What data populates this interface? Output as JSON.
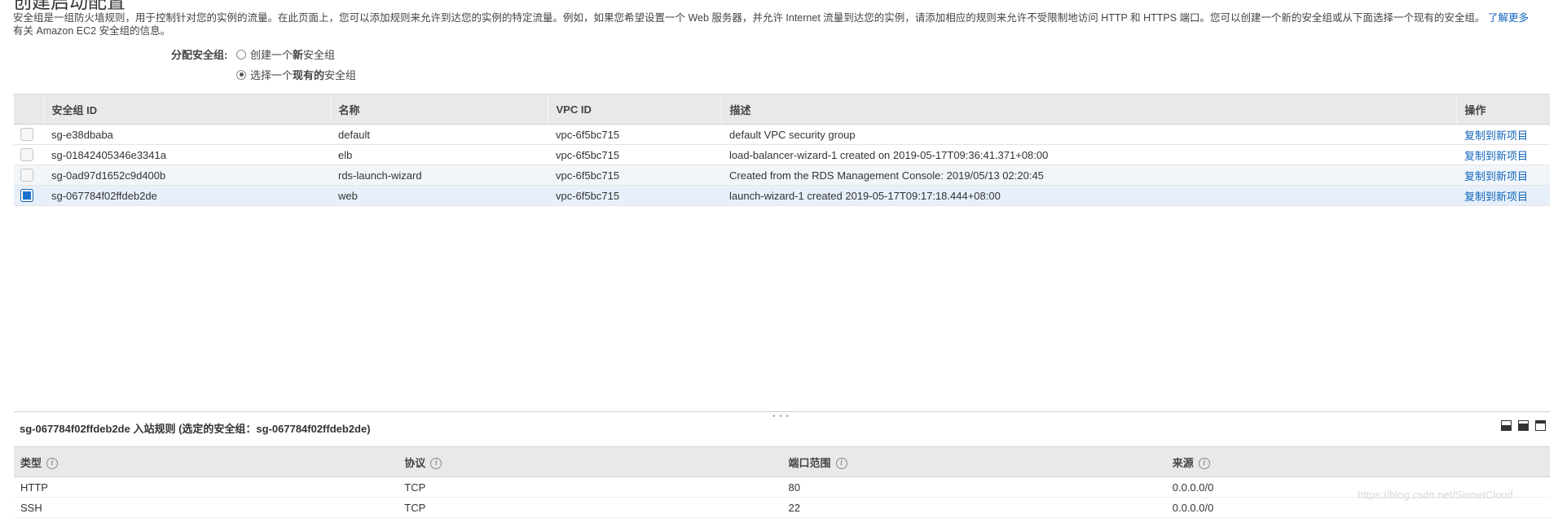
{
  "page": {
    "title": "创建启动配置",
    "description": "安全组是一组防火墙规则，用于控制针对您的实例的流量。在此页面上，您可以添加规则来允许到达您的实例的特定流量。例如，如果您希望设置一个 Web 服务器，并允许 Internet 流量到达您的实例，请添加相应的规则来允许不受限制地访问 HTTP 和 HTTPS 端口。您可以创建一个新的安全组或从下面选择一个现有的安全组。",
    "learn_more": "了解更多",
    "description_tail": "有关 Amazon EC2 安全组的信息。"
  },
  "assign": {
    "label": "分配安全组:",
    "option_new_prefix": "创建一个",
    "option_new_bold": "新",
    "option_new_suffix": "安全组",
    "option_existing_prefix": "选择一个",
    "option_existing_bold": "现有的",
    "option_existing_suffix": "安全组",
    "selected": "existing"
  },
  "groups_table": {
    "columns": [
      "安全组 ID",
      "名称",
      "VPC ID",
      "描述",
      "操作"
    ],
    "rows": [
      {
        "id": "sg-e38dbaba",
        "name": "default",
        "vpc": "vpc-6f5bc715",
        "desc": "default VPC security group",
        "action": "复制到新项目",
        "checked": false
      },
      {
        "id": "sg-01842405346e3341a",
        "name": "elb",
        "vpc": "vpc-6f5bc715",
        "desc": "load-balancer-wizard-1 created on 2019-05-17T09:36:41.371+08:00",
        "action": "复制到新项目",
        "checked": false
      },
      {
        "id": "sg-0ad97d1652c9d400b",
        "name": "rds-launch-wizard",
        "vpc": "vpc-6f5bc715",
        "desc": "Created from the RDS Management Console: 2019/05/13 02:20:45",
        "action": "复制到新项目",
        "checked": false
      },
      {
        "id": "sg-067784f02ffdeb2de",
        "name": "web",
        "vpc": "vpc-6f5bc715",
        "desc": "launch-wizard-1 created 2019-05-17T09:17:18.444+08:00",
        "action": "复制到新项目",
        "checked": true
      }
    ]
  },
  "rules": {
    "title": "sg-067784f02ffdeb2de 入站规则 (选定的安全组：sg-067784f02ffdeb2de)",
    "columns": [
      "类型",
      "协议",
      "端口范围",
      "来源"
    ],
    "rows": [
      {
        "type": "HTTP",
        "protocol": "TCP",
        "port": "80",
        "source": "0.0.0.0/0"
      },
      {
        "type": "SSH",
        "protocol": "TCP",
        "port": "22",
        "source": "0.0.0.0/0"
      }
    ]
  },
  "watermark": "https://blog.csdn.net/SinnetCloud",
  "colors": {
    "link": "#1166bb",
    "header_bg": "#e9e9e9",
    "selected_row": "#e7f0fa",
    "checkbox_on": "#1a6fc9"
  }
}
